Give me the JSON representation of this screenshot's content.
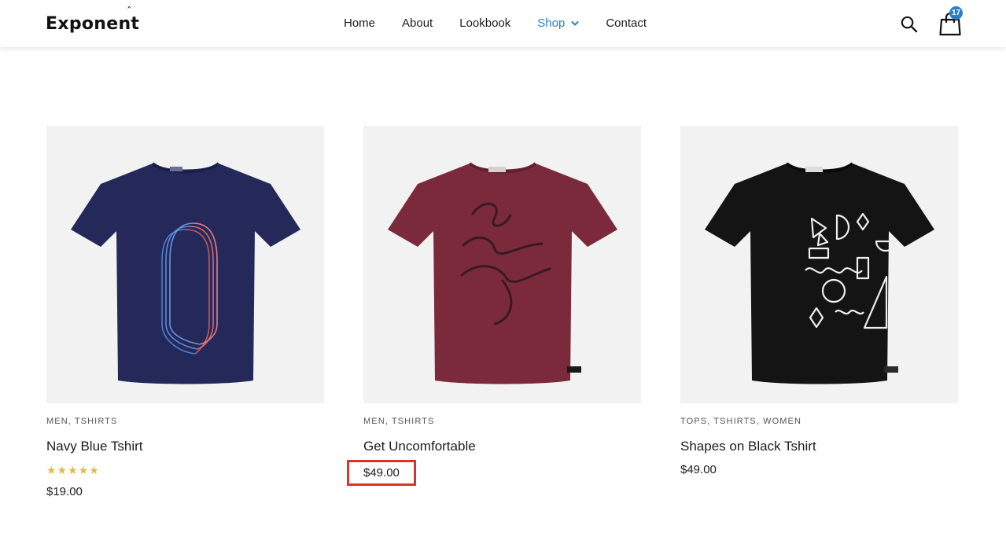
{
  "header": {
    "logo": "Exponent",
    "logo_accent": "ˆ",
    "nav": [
      {
        "label": "Home",
        "active": false
      },
      {
        "label": "About",
        "active": false
      },
      {
        "label": "Lookbook",
        "active": false
      },
      {
        "label": "Shop",
        "active": true,
        "has_dropdown": true
      },
      {
        "label": "Contact",
        "active": false
      }
    ],
    "search_icon": "search-icon",
    "cart_icon": "shopping-bag-icon",
    "cart_count": "17"
  },
  "colors": {
    "accent": "#2b7fc4",
    "star": "#e0b94c",
    "highlight": "#d9342b"
  },
  "products": [
    {
      "categories": [
        "MEN",
        "TSHIRTS"
      ],
      "title": "Navy Blue Tshirt",
      "rating_stars": "★★★★★",
      "rating_value": 5,
      "price": "$19.00",
      "image": "navy-tshirt-image"
    },
    {
      "categories": [
        "MEN",
        "TSHIRTS"
      ],
      "title": "Get Uncomfortable",
      "price": "$49.00",
      "price_highlighted": true,
      "image": "maroon-tshirt-image"
    },
    {
      "categories": [
        "TOPS",
        "TSHIRTS",
        "WOMEN"
      ],
      "title": "Shapes on Black Tshirt",
      "price": "$49.00",
      "image": "black-tshirt-image"
    }
  ]
}
